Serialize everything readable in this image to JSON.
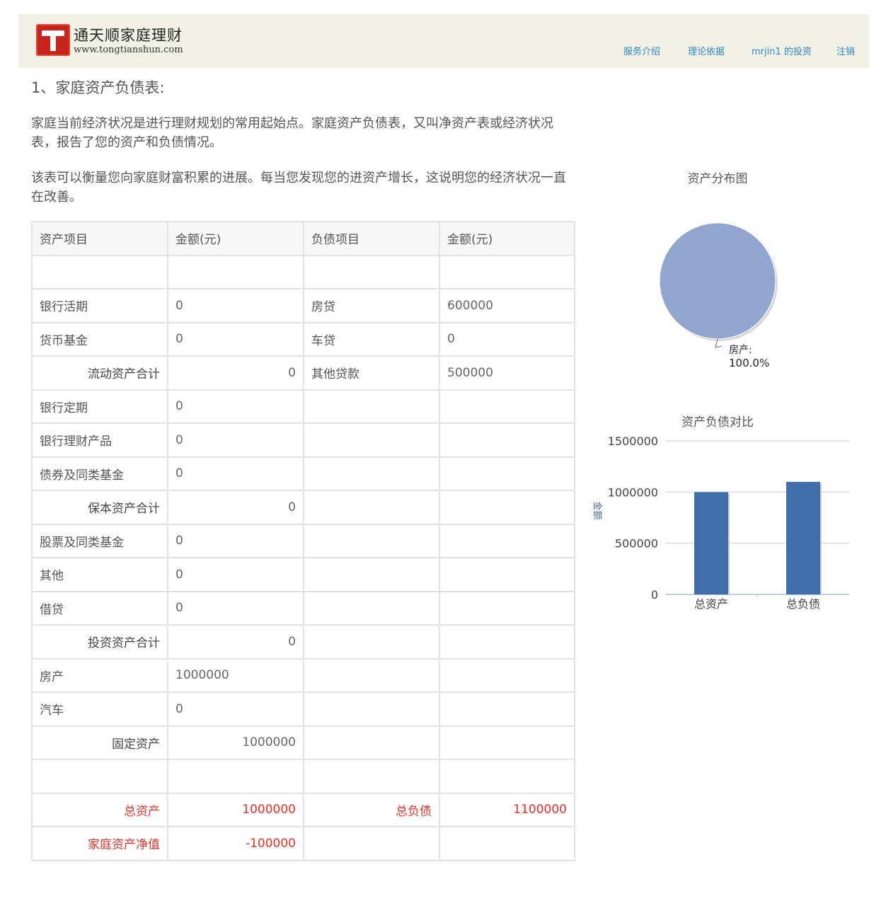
{
  "header": {
    "brand_name": "通天顺家庭理财",
    "brand_url": "www.tongtianshun.com",
    "nav": [
      {
        "label": "服务介绍"
      },
      {
        "label": "理论依据"
      },
      {
        "label": "mrjin1 的投资"
      },
      {
        "label": "注销"
      }
    ]
  },
  "main": {
    "section_title": "1、家庭资产负债表:",
    "paragraph1": "家庭当前经济状况是进行理财规划的常用起始点。家庭资产负债表，又叫净资产表或经济状况表，报告了您的资产和负债情况。",
    "paragraph2": "该表可以衡量您向家庭财富积累的进展。每当您发现您的进资产增长，这说明您的经济状况一直在改善。"
  },
  "table": {
    "headers": [
      "资产项目",
      "金额(元)",
      "负债项目",
      "金额(元)"
    ],
    "rows": [
      {
        "kind": "plain",
        "cells": [
          "",
          "",
          "",
          ""
        ]
      },
      {
        "kind": "plain",
        "cells": [
          "银行活期",
          "0",
          "房贷",
          "600000"
        ]
      },
      {
        "kind": "plain",
        "cells": [
          "货币基金",
          "0",
          "车贷",
          "0"
        ]
      },
      {
        "kind": "subtotal",
        "cells": [
          "流动资产合计",
          "0",
          "其他贷款",
          "500000"
        ]
      },
      {
        "kind": "plain",
        "cells": [
          "银行定期",
          "0",
          "",
          ""
        ]
      },
      {
        "kind": "plain",
        "cells": [
          "银行理财产品",
          "0",
          "",
          ""
        ]
      },
      {
        "kind": "plain",
        "cells": [
          "债券及同类基金",
          "0",
          "",
          ""
        ]
      },
      {
        "kind": "subtotal",
        "cells": [
          "保本资产合计",
          "0",
          "",
          ""
        ]
      },
      {
        "kind": "plain",
        "cells": [
          "股票及同类基金",
          "0",
          "",
          ""
        ]
      },
      {
        "kind": "plain",
        "cells": [
          "其他",
          "0",
          "",
          ""
        ]
      },
      {
        "kind": "plain",
        "cells": [
          "借贷",
          "0",
          "",
          ""
        ]
      },
      {
        "kind": "subtotal",
        "cells": [
          "投资资产合计",
          "0",
          "",
          ""
        ]
      },
      {
        "kind": "plain",
        "cells": [
          "房产",
          "1000000",
          "",
          ""
        ]
      },
      {
        "kind": "plain",
        "cells": [
          "汽车",
          "0",
          "",
          ""
        ]
      },
      {
        "kind": "subtotal",
        "cells": [
          "固定资产",
          "1000000",
          "",
          ""
        ]
      },
      {
        "kind": "plain",
        "cells": [
          "",
          "",
          "",
          ""
        ]
      },
      {
        "kind": "total",
        "cells": [
          "总资产",
          "1000000",
          "总负债",
          "1100000"
        ]
      },
      {
        "kind": "net",
        "cells": [
          "家庭资产净值",
          "-100000",
          "",
          ""
        ]
      }
    ]
  },
  "colors": {
    "accent_red": "#e8332b",
    "nav_blue": "#2f86c5",
    "pie_fill": "#91a5cf",
    "bar_fill": "#3f6ea9"
  },
  "chart_data": [
    {
      "type": "pie",
      "title": "资产分布图",
      "slices": [
        {
          "label": "房产",
          "value": 100.0,
          "display": "100.0%"
        }
      ]
    },
    {
      "type": "bar",
      "title": "资产负债对比",
      "categories": [
        "总资产",
        "总负债"
      ],
      "values": [
        1000000,
        1100000
      ],
      "ylabel": "金额",
      "ylim": [
        0,
        1500000
      ],
      "yticks": [
        "0",
        "500000",
        "1000000",
        "1500000"
      ],
      "grid": true
    }
  ]
}
